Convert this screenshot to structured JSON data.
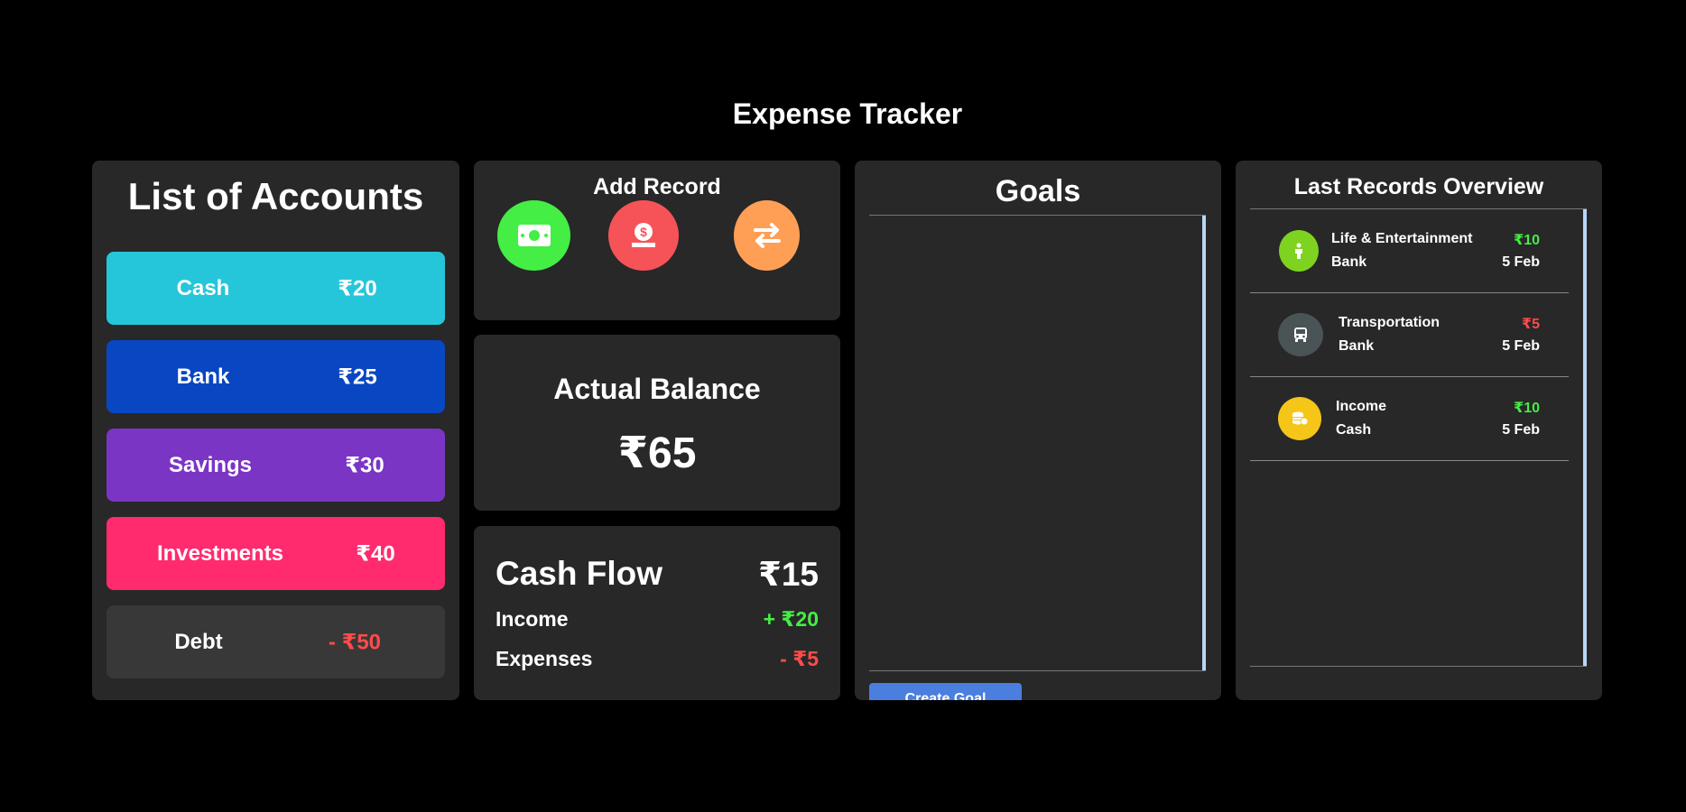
{
  "app": {
    "title": "Expense Tracker"
  },
  "accounts": {
    "title": "List of Accounts",
    "items": [
      {
        "name": "Cash",
        "amount": "₹20",
        "color": "#26c6da"
      },
      {
        "name": "Bank",
        "amount": "₹25",
        "color": "#0946c2"
      },
      {
        "name": "Savings",
        "amount": "₹30",
        "color": "#7b35c5"
      },
      {
        "name": "Investments",
        "amount": "₹40",
        "color": "#ff2b6e"
      },
      {
        "name": "Debt",
        "amount": "- ₹50",
        "color": "#383838",
        "amount_color": "#ff4b4b"
      }
    ]
  },
  "add_record": {
    "title": "Add Record",
    "buttons": [
      {
        "icon": "cash-icon",
        "color": "#44ee44"
      },
      {
        "icon": "money-bag-icon",
        "color": "#f65358"
      },
      {
        "icon": "transfer-icon",
        "color": "#ff9f56"
      }
    ]
  },
  "balance": {
    "label": "Actual Balance",
    "value": "₹65"
  },
  "cash_flow": {
    "label": "Cash Flow",
    "total": "₹15",
    "income_label": "Income",
    "income_value": "+ ₹20",
    "expenses_label": "Expenses",
    "expenses_value": "- ₹5",
    "income_color": "#44ee44",
    "expenses_color": "#ff4b4b"
  },
  "goals": {
    "title": "Goals",
    "create_button": "Create Goal"
  },
  "records": {
    "title": "Last Records Overview",
    "items": [
      {
        "category": "Life & Entertainment",
        "account": "Bank",
        "amount": "₹10",
        "date": "5 Feb",
        "amount_color": "#44ee44",
        "icon": "person-icon",
        "icon_color": "#7ed321"
      },
      {
        "category": "Transportation",
        "account": "Bank",
        "amount": "₹5",
        "date": "5 Feb",
        "amount_color": "#ff4b4b",
        "icon": "bus-icon",
        "icon_color": "#4a5356"
      },
      {
        "category": "Income",
        "account": "Cash",
        "amount": "₹10",
        "date": "5 Feb",
        "amount_color": "#44ee44",
        "icon": "coins-icon",
        "icon_color": "#f5c518"
      }
    ]
  }
}
